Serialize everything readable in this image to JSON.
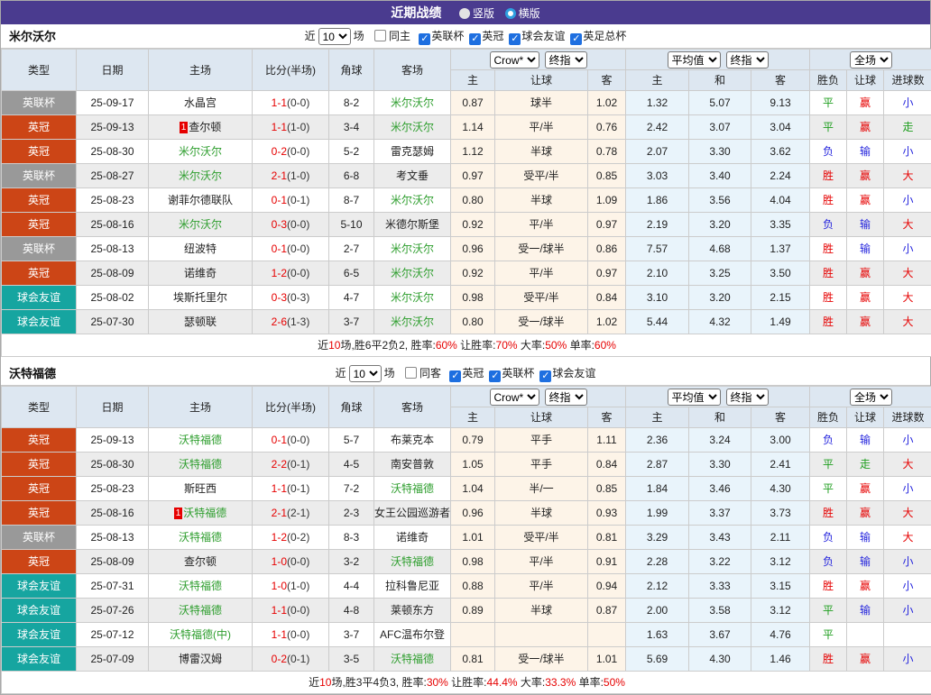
{
  "title": {
    "label": "近期战绩",
    "vertical": "竖版",
    "horizontal": "横版",
    "selected": "横版"
  },
  "labels": {
    "near": "近",
    "matches": "场"
  },
  "columns": {
    "main": [
      "类型",
      "日期",
      "主场",
      "比分(半场)",
      "角球",
      "客场"
    ],
    "group1": [
      "主",
      "让球",
      "客"
    ],
    "group2": [
      "主",
      "和",
      "客"
    ],
    "group3": [
      "胜负",
      "让球",
      "进球数"
    ],
    "selects": {
      "crow": "Crow*",
      "final1": "终指",
      "avg": "平均值",
      "final2": "终指",
      "scope": "全场"
    }
  },
  "colors": {
    "title_bar": "#4a3b8f",
    "league_cup_badge": "#999999",
    "championship_badge": "#cc4516",
    "friendly_badge": "#16a5a0",
    "focus_team": "#2e9e2e",
    "win_text": "#e60000",
    "draw_text": "#1e9e1e",
    "lose_text": "#2525dd",
    "crow_col_bg": "#fdf4e8",
    "avg_col_bg": "#e9f4fb"
  },
  "teams": [
    {
      "name": "米尔沃尔",
      "count": "10",
      "same_label": "同主",
      "same_checked": false,
      "leagues": [
        "英联杯",
        "英冠",
        "球会友谊",
        "英足总杯"
      ],
      "rows": [
        {
          "league": "英联杯",
          "date": "25-09-17",
          "home": "水晶宫",
          "home_focus": false,
          "redcard": "",
          "ft": "1-1",
          "ht": "(0-0)",
          "corner": "8-2",
          "away": "米尔沃尔",
          "away_focus": true,
          "crow": [
            "0.87",
            "球半",
            "1.02"
          ],
          "avg": [
            "1.32",
            "5.07",
            "9.13"
          ],
          "res": [
            "平",
            "赢",
            "小"
          ]
        },
        {
          "league": "英冠",
          "date": "25-09-13",
          "home": "查尔顿",
          "home_focus": false,
          "redcard": "1",
          "ft": "1-1",
          "ht": "(1-0)",
          "corner": "3-4",
          "away": "米尔沃尔",
          "away_focus": true,
          "crow": [
            "1.14",
            "平/半",
            "0.76"
          ],
          "avg": [
            "2.42",
            "3.07",
            "3.04"
          ],
          "res": [
            "平",
            "赢",
            "走"
          ]
        },
        {
          "league": "英冠",
          "date": "25-08-30",
          "home": "米尔沃尔",
          "home_focus": true,
          "redcard": "",
          "ft": "0-2",
          "ht": "(0-0)",
          "corner": "5-2",
          "away": "雷克瑟姆",
          "away_focus": false,
          "crow": [
            "1.12",
            "半球",
            "0.78"
          ],
          "avg": [
            "2.07",
            "3.30",
            "3.62"
          ],
          "res": [
            "负",
            "输",
            "小"
          ]
        },
        {
          "league": "英联杯",
          "date": "25-08-27",
          "home": "米尔沃尔",
          "home_focus": true,
          "redcard": "",
          "ft": "2-1",
          "ht": "(1-0)",
          "corner": "6-8",
          "away": "考文垂",
          "away_focus": false,
          "crow": [
            "0.97",
            "受平/半",
            "0.85"
          ],
          "avg": [
            "3.03",
            "3.40",
            "2.24"
          ],
          "res": [
            "胜",
            "赢",
            "大"
          ]
        },
        {
          "league": "英冠",
          "date": "25-08-23",
          "home": "谢菲尔德联队",
          "home_focus": false,
          "redcard": "",
          "ft": "0-1",
          "ht": "(0-1)",
          "corner": "8-7",
          "away": "米尔沃尔",
          "away_focus": true,
          "crow": [
            "0.80",
            "半球",
            "1.09"
          ],
          "avg": [
            "1.86",
            "3.56",
            "4.04"
          ],
          "res": [
            "胜",
            "赢",
            "小"
          ]
        },
        {
          "league": "英冠",
          "date": "25-08-16",
          "home": "米尔沃尔",
          "home_focus": true,
          "redcard": "",
          "ft": "0-3",
          "ht": "(0-0)",
          "corner": "5-10",
          "away": "米德尔斯堡",
          "away_focus": false,
          "crow": [
            "0.92",
            "平/半",
            "0.97"
          ],
          "avg": [
            "2.19",
            "3.20",
            "3.35"
          ],
          "res": [
            "负",
            "输",
            "大"
          ]
        },
        {
          "league": "英联杯",
          "date": "25-08-13",
          "home": "纽波特",
          "home_focus": false,
          "redcard": "",
          "ft": "0-1",
          "ht": "(0-0)",
          "corner": "2-7",
          "away": "米尔沃尔",
          "away_focus": true,
          "crow": [
            "0.96",
            "受一/球半",
            "0.86"
          ],
          "avg": [
            "7.57",
            "4.68",
            "1.37"
          ],
          "res": [
            "胜",
            "输",
            "小"
          ]
        },
        {
          "league": "英冠",
          "date": "25-08-09",
          "home": "诺维奇",
          "home_focus": false,
          "redcard": "",
          "ft": "1-2",
          "ht": "(0-0)",
          "corner": "6-5",
          "away": "米尔沃尔",
          "away_focus": true,
          "crow": [
            "0.92",
            "平/半",
            "0.97"
          ],
          "avg": [
            "2.10",
            "3.25",
            "3.50"
          ],
          "res": [
            "胜",
            "赢",
            "大"
          ]
        },
        {
          "league": "球会友谊",
          "date": "25-08-02",
          "home": "埃斯托里尔",
          "home_focus": false,
          "redcard": "",
          "ft": "0-3",
          "ht": "(0-3)",
          "corner": "4-7",
          "away": "米尔沃尔",
          "away_focus": true,
          "crow": [
            "0.98",
            "受平/半",
            "0.84"
          ],
          "avg": [
            "3.10",
            "3.20",
            "2.15"
          ],
          "res": [
            "胜",
            "赢",
            "大"
          ]
        },
        {
          "league": "球会友谊",
          "date": "25-07-30",
          "home": "瑟顿联",
          "home_focus": false,
          "redcard": "",
          "ft": "2-6",
          "ht": "(1-3)",
          "corner": "3-7",
          "away": "米尔沃尔",
          "away_focus": true,
          "crow": [
            "0.80",
            "受一/球半",
            "1.02"
          ],
          "avg": [
            "5.44",
            "4.32",
            "1.49"
          ],
          "res": [
            "胜",
            "赢",
            "大"
          ]
        }
      ],
      "summary_parts": [
        {
          "t": "近",
          "r": false
        },
        {
          "t": "10",
          "r": true
        },
        {
          "t": "场,胜6平2负2, 胜率:",
          "r": false
        },
        {
          "t": "60%",
          "r": true
        },
        {
          "t": " 让胜率:",
          "r": false
        },
        {
          "t": "70%",
          "r": true
        },
        {
          "t": " 大率:",
          "r": false
        },
        {
          "t": "50%",
          "r": true
        },
        {
          "t": " 单率:",
          "r": false
        },
        {
          "t": "60%",
          "r": true
        }
      ]
    },
    {
      "name": "沃特福德",
      "count": "10",
      "same_label": "同客",
      "same_checked": false,
      "leagues": [
        "英冠",
        "英联杯",
        "球会友谊"
      ],
      "rows": [
        {
          "league": "英冠",
          "date": "25-09-13",
          "home": "沃特福德",
          "home_focus": true,
          "redcard": "",
          "ft": "0-1",
          "ht": "(0-0)",
          "corner": "5-7",
          "away": "布莱克本",
          "away_focus": false,
          "crow": [
            "0.79",
            "平手",
            "1.11"
          ],
          "avg": [
            "2.36",
            "3.24",
            "3.00"
          ],
          "res": [
            "负",
            "输",
            "小"
          ]
        },
        {
          "league": "英冠",
          "date": "25-08-30",
          "home": "沃特福德",
          "home_focus": true,
          "redcard": "",
          "ft": "2-2",
          "ht": "(0-1)",
          "corner": "4-5",
          "away": "南安普敦",
          "away_focus": false,
          "crow": [
            "1.05",
            "平手",
            "0.84"
          ],
          "avg": [
            "2.87",
            "3.30",
            "2.41"
          ],
          "res": [
            "平",
            "走",
            "大"
          ]
        },
        {
          "league": "英冠",
          "date": "25-08-23",
          "home": "斯旺西",
          "home_focus": false,
          "redcard": "",
          "ft": "1-1",
          "ht": "(0-1)",
          "corner": "7-2",
          "away": "沃特福德",
          "away_focus": true,
          "crow": [
            "1.04",
            "半/一",
            "0.85"
          ],
          "avg": [
            "1.84",
            "3.46",
            "4.30"
          ],
          "res": [
            "平",
            "赢",
            "小"
          ]
        },
        {
          "league": "英冠",
          "date": "25-08-16",
          "home": "沃特福德",
          "home_focus": true,
          "redcard": "1",
          "ft": "2-1",
          "ht": "(2-1)",
          "corner": "2-3",
          "away": "女王公园巡游者",
          "away_focus": false,
          "crow": [
            "0.96",
            "半球",
            "0.93"
          ],
          "avg": [
            "1.99",
            "3.37",
            "3.73"
          ],
          "res": [
            "胜",
            "赢",
            "大"
          ]
        },
        {
          "league": "英联杯",
          "date": "25-08-13",
          "home": "沃特福德",
          "home_focus": true,
          "redcard": "",
          "ft": "1-2",
          "ht": "(0-2)",
          "corner": "8-3",
          "away": "诺维奇",
          "away_focus": false,
          "crow": [
            "1.01",
            "受平/半",
            "0.81"
          ],
          "avg": [
            "3.29",
            "3.43",
            "2.11"
          ],
          "res": [
            "负",
            "输",
            "大"
          ]
        },
        {
          "league": "英冠",
          "date": "25-08-09",
          "home": "查尔顿",
          "home_focus": false,
          "redcard": "",
          "ft": "1-0",
          "ht": "(0-0)",
          "corner": "3-2",
          "away": "沃特福德",
          "away_focus": true,
          "crow": [
            "0.98",
            "平/半",
            "0.91"
          ],
          "avg": [
            "2.28",
            "3.22",
            "3.12"
          ],
          "res": [
            "负",
            "输",
            "小"
          ]
        },
        {
          "league": "球会友谊",
          "date": "25-07-31",
          "home": "沃特福德",
          "home_focus": true,
          "redcard": "",
          "ft": "1-0",
          "ht": "(1-0)",
          "corner": "4-4",
          "away": "拉科鲁尼亚",
          "away_focus": false,
          "crow": [
            "0.88",
            "平/半",
            "0.94"
          ],
          "avg": [
            "2.12",
            "3.33",
            "3.15"
          ],
          "res": [
            "胜",
            "赢",
            "小"
          ]
        },
        {
          "league": "球会友谊",
          "date": "25-07-26",
          "home": "沃特福德",
          "home_focus": true,
          "redcard": "",
          "ft": "1-1",
          "ht": "(0-0)",
          "corner": "4-8",
          "away": "莱顿东方",
          "away_focus": false,
          "crow": [
            "0.89",
            "半球",
            "0.87"
          ],
          "avg": [
            "2.00",
            "3.58",
            "3.12"
          ],
          "res": [
            "平",
            "输",
            "小"
          ]
        },
        {
          "league": "球会友谊",
          "date": "25-07-12",
          "home": "沃特福德(中)",
          "home_focus": true,
          "redcard": "",
          "ft": "1-1",
          "ht": "(0-0)",
          "corner": "3-7",
          "away": "AFC温布尔登",
          "away_focus": false,
          "crow": [
            "",
            "",
            ""
          ],
          "avg": [
            "1.63",
            "3.67",
            "4.76"
          ],
          "res": [
            "平",
            "",
            ""
          ]
        },
        {
          "league": "球会友谊",
          "date": "25-07-09",
          "home": "博雷汉姆",
          "home_focus": false,
          "redcard": "",
          "ft": "0-2",
          "ht": "(0-1)",
          "corner": "3-5",
          "away": "沃特福德",
          "away_focus": true,
          "crow": [
            "0.81",
            "受一/球半",
            "1.01"
          ],
          "avg": [
            "5.69",
            "4.30",
            "1.46"
          ],
          "res": [
            "胜",
            "赢",
            "小"
          ]
        }
      ],
      "summary_parts": [
        {
          "t": "近",
          "r": false
        },
        {
          "t": "10",
          "r": true
        },
        {
          "t": "场,胜3平4负3, 胜率:",
          "r": false
        },
        {
          "t": "30%",
          "r": true
        },
        {
          "t": " 让胜率:",
          "r": false
        },
        {
          "t": "44.4%",
          "r": true
        },
        {
          "t": " 大率:",
          "r": false
        },
        {
          "t": "33.3%",
          "r": true
        },
        {
          "t": " 单率:",
          "r": false
        },
        {
          "t": "50%",
          "r": true
        }
      ]
    }
  ]
}
